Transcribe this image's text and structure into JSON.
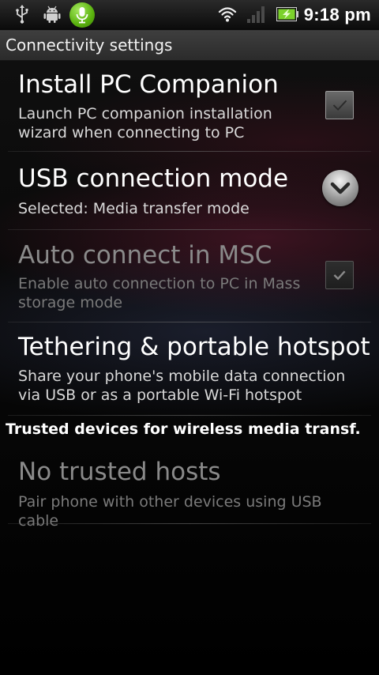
{
  "status_bar": {
    "time": "9:18 pm",
    "icons": [
      "usb-icon",
      "android-debug-icon",
      "voice-mic-icon",
      "wifi-icon",
      "signal-icon",
      "battery-charging-icon"
    ],
    "colors": {
      "mic": "#59b10d",
      "battery": "#7cd12b"
    }
  },
  "title_bar": {
    "title": "Connectivity settings"
  },
  "preferences": [
    {
      "title": "Install PC Companion",
      "summary": "Launch PC companion installation wizard when connecting to PC",
      "widget": "checkbox",
      "checked": true,
      "enabled": true
    },
    {
      "title": "USB connection mode",
      "summary": "Selected: Media transfer mode",
      "widget": "chevron-down-icon",
      "enabled": true
    },
    {
      "title": "Auto connect in MSC",
      "summary": "Enable auto connection to PC in Mass storage mode",
      "widget": "checkbox",
      "checked": true,
      "enabled": false
    },
    {
      "title": "Tethering & portable hotspot",
      "summary": "Share your phone's mobile data connection via USB or as a portable Wi-Fi hotspot",
      "enabled": true
    }
  ],
  "category": {
    "header": "Trusted devices for wireless media transf."
  },
  "trusted_hosts": {
    "title": "No trusted hosts",
    "summary": "Pair phone with other devices using USB cable",
    "enabled": false
  }
}
